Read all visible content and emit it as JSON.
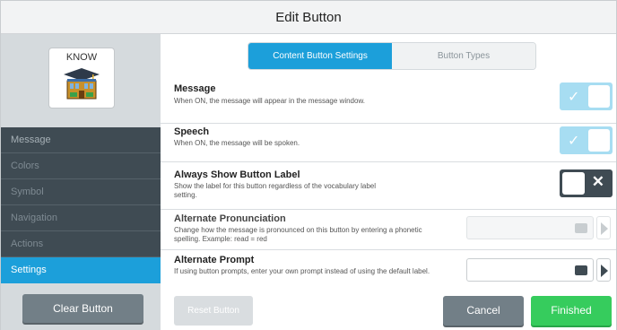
{
  "window": {
    "title": "Edit Button"
  },
  "preview": {
    "label": "KNOW"
  },
  "sidebar": {
    "items": [
      {
        "label": "Message",
        "active": false
      },
      {
        "label": "Colors",
        "active": false
      },
      {
        "label": "Symbol",
        "active": false
      },
      {
        "label": "Navigation",
        "active": false
      },
      {
        "label": "Actions",
        "active": false
      },
      {
        "label": "Settings",
        "active": true
      }
    ],
    "clear_button": "Clear Button"
  },
  "tabs": [
    {
      "label": "Content Button Settings",
      "active": true
    },
    {
      "label": "Button Types",
      "active": false
    }
  ],
  "settings": {
    "message": {
      "title": "Message",
      "description": "When ON, the message will appear in the message window.",
      "state": "on"
    },
    "speech": {
      "title": "Speech",
      "description": "When ON, the message will be spoken.",
      "state": "on"
    },
    "always_show_label": {
      "title": "Always Show Button Label",
      "description": "Show the label for this button regardless of the vocabulary label setting.",
      "state": "off"
    },
    "alternate_pronunciation": {
      "title": "Alternate Pronunciation",
      "description": "Change how the message is pronounced on this button by entering a phonetic spelling. Example: read = red",
      "value": ""
    },
    "alternate_prompt": {
      "title": "Alternate Prompt",
      "description": "If using button prompts, enter your own prompt instead of using the default label.",
      "value": ""
    }
  },
  "footer": {
    "reset_button": "Reset Button",
    "cancel_button": "Cancel",
    "finished_button": "Finished"
  },
  "colors": {
    "accent": "#1c9fda",
    "sidebar_dark": "#3f4b53",
    "finished": "#36cc5d",
    "toggle_on": "#a7ddf2"
  }
}
